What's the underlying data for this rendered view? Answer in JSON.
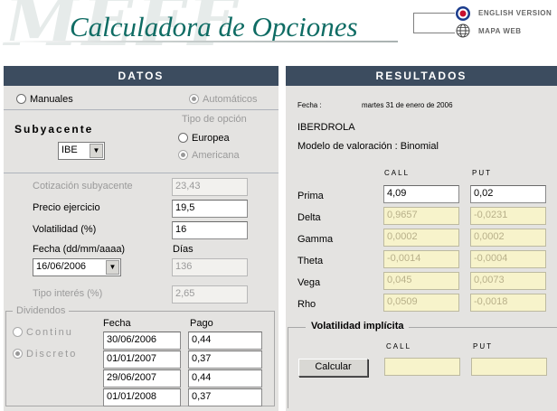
{
  "header": {
    "watermark": "MEFF",
    "title": "Calculadora de Opciones",
    "links": [
      {
        "label": "ENGLISH VERSION",
        "icon": "uk-flag-icon"
      },
      {
        "label": "MAPA WEB",
        "icon": "globe-icon"
      }
    ]
  },
  "datos": {
    "title": "DATOS",
    "mode_options": [
      {
        "label": "Manuales",
        "selected": false
      },
      {
        "label": "Automáticos",
        "selected": true
      }
    ],
    "subyacente_label": "Subyacente",
    "subyacente_value": "IBE",
    "tipo_opcion_label": "Tipo de opción",
    "tipo_opcion_options": [
      {
        "label": "Europea",
        "selected": false
      },
      {
        "label": "Americana",
        "selected": true
      }
    ],
    "cotizacion_label": "Cotización subyacente",
    "cotizacion_value": "23,43",
    "precio_label": "Precio ejercicio",
    "precio_value": "19,5",
    "volatilidad_label": "Volatilidad (%)",
    "volatilidad_value": "16",
    "fecha_label": "Fecha (dd/mm/aaaa)",
    "fecha_value": "16/06/2006",
    "dias_label": "Días",
    "dias_value": "136",
    "interes_label": "Tipo interés (%)",
    "interes_value": "2,65",
    "dividendos": {
      "legend": "Dividendos",
      "options": [
        {
          "label": "Continu",
          "selected": false
        },
        {
          "label": "Discreto",
          "selected": true
        }
      ],
      "fecha_header": "Fecha",
      "pago_header": "Pago",
      "rows": [
        {
          "fecha": "30/06/2006",
          "pago": "0,44"
        },
        {
          "fecha": "01/01/2007",
          "pago": "0,37"
        },
        {
          "fecha": "29/06/2007",
          "pago": "0,44"
        },
        {
          "fecha": "01/01/2008",
          "pago": "0,37"
        }
      ]
    }
  },
  "resultados": {
    "title": "RESULTADOS",
    "fecha_label": "Fecha :",
    "fecha_value": "martes 31 de enero de 2006",
    "company": "IBERDROLA",
    "modelo": "Modelo de valoración : Binomial",
    "call_header": "CALL",
    "put_header": "PUT",
    "rows": [
      {
        "label": "Prima",
        "call": "4,09",
        "put": "0,02"
      },
      {
        "label": "Delta",
        "call": "0,9657",
        "put": "-0,0231"
      },
      {
        "label": "Gamma",
        "call": "0,0002",
        "put": "0,0002"
      },
      {
        "label": "Theta",
        "call": "-0,0014",
        "put": "-0,0004"
      },
      {
        "label": "Vega",
        "call": "0,045",
        "put": "0,0073"
      },
      {
        "label": "Rho",
        "call": "0,0509",
        "put": "-0,0018"
      }
    ],
    "vol_implicita": {
      "legend": "Volatilidad implícita",
      "call_header": "CALL",
      "put_header": "PUT",
      "button": "Calcular",
      "call_value": "",
      "put_value": ""
    }
  },
  "colors": {
    "panel_header": "#3c4c5f",
    "panel_bg": "#e4e3e1",
    "title_teal": "#0f6c64",
    "result_field": "#f7f3cb"
  }
}
